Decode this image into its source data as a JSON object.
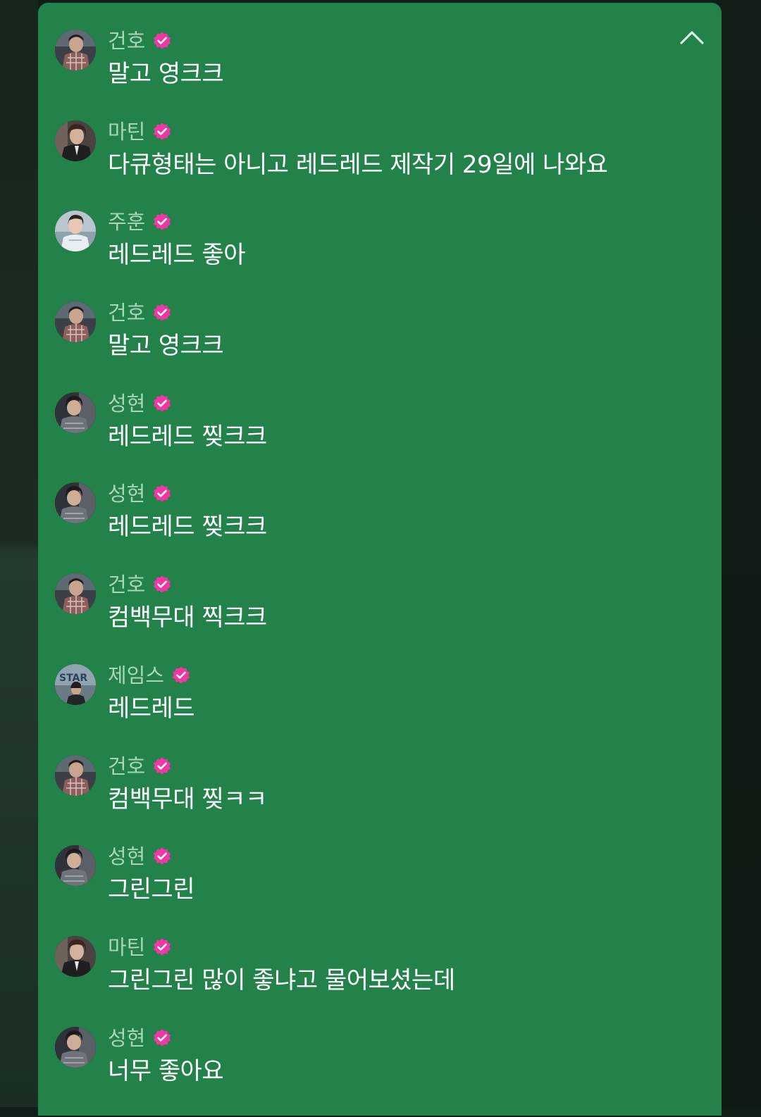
{
  "colors": {
    "panel_bg": "#23824a",
    "name_text": "#a9d6b7",
    "message_text": "#ffffff",
    "verified_badge": "#f236a4"
  },
  "header": {
    "collapse_icon": "chevron-up-icon"
  },
  "messages": [
    {
      "name": "건호",
      "text": "말고 영크크",
      "avatar": "guntho"
    },
    {
      "name": "마틴",
      "text": "다큐형태는 아니고 레드레드 제작기 29일에 나와요",
      "avatar": "martin"
    },
    {
      "name": "주훈",
      "text": "레드레드 좋아",
      "avatar": "juhoon"
    },
    {
      "name": "건호",
      "text": "말고 영크크",
      "avatar": "guntho"
    },
    {
      "name": "성현",
      "text": "레드레드 찢크크",
      "avatar": "sunghyun"
    },
    {
      "name": "성현",
      "text": "레드레드 찢크크",
      "avatar": "sunghyun"
    },
    {
      "name": "건호",
      "text": "컴백무대 찍크크",
      "avatar": "guntho"
    },
    {
      "name": "제임스",
      "text": "레드레드",
      "avatar": "james"
    },
    {
      "name": "건호",
      "text": "컴백무대 찢ㅋㅋ",
      "avatar": "guntho"
    },
    {
      "name": "성현",
      "text": "그린그린",
      "avatar": "sunghyun"
    },
    {
      "name": "마틴",
      "text": "그린그린 많이 좋냐고 물어보셨는데",
      "avatar": "martin"
    },
    {
      "name": "성현",
      "text": "너무 좋아요",
      "avatar": "sunghyun"
    }
  ]
}
